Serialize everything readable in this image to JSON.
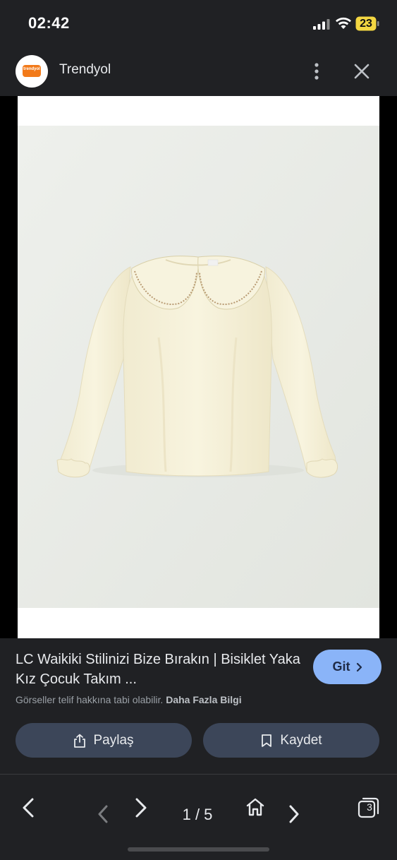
{
  "status_bar": {
    "time": "02:42",
    "battery_level": "23"
  },
  "app_bar": {
    "logo_text": "trendyol",
    "title": "Trendyol",
    "menu_icon": "more-vert-icon",
    "close_icon": "close-icon"
  },
  "image": {
    "description_icon": "product-photo-blouse",
    "background_color": "#e9ece7",
    "garment_color": "#f5f1dc"
  },
  "result": {
    "title": "LC Waikiki Stilinizi Bize Bırakın | Bisiklet Yaka Kız Çocuk Takım ...",
    "copyright_notice": "Görseller telif hakkına tabi olabilir.",
    "more_info_link": "Daha Fazla Bilgi",
    "go_button": "Git",
    "share_button": "Paylaş",
    "save_button": "Kaydet"
  },
  "bottom_nav": {
    "counter": "1 / 5",
    "tabs_count": "3"
  },
  "colors": {
    "bar_background": "#202124",
    "accent_blue": "#8ab4f8",
    "button_background": "#3c4659",
    "battery_yellow": "#f4d742",
    "trendyol_orange": "#f27a1a"
  }
}
